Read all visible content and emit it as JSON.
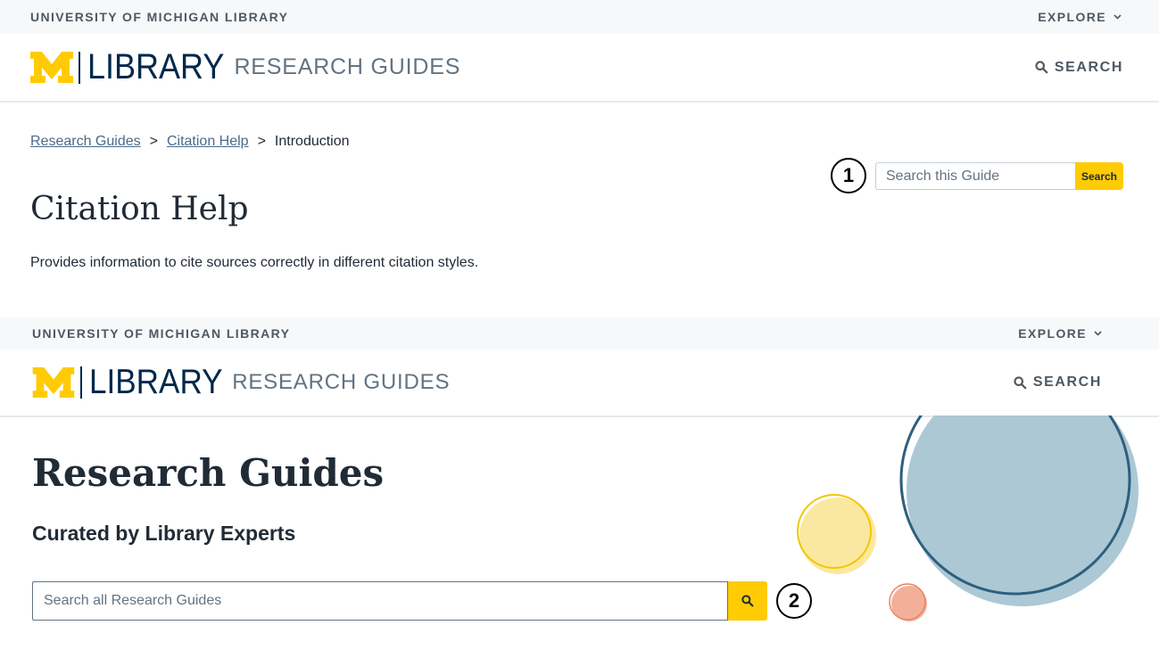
{
  "colors": {
    "maize": "#ffcb05",
    "blue": "#00274c",
    "gray_text": "#4e5862",
    "light_gray": "#f7f8f9"
  },
  "top_banner": {
    "university_label": "UNIVERSITY OF MICHIGAN LIBRARY",
    "explore_label": "EXPLORE",
    "explore_icon": "chevron-down-icon"
  },
  "header": {
    "logo_letter": "M",
    "library_label": "LIBRARY",
    "research_guides_label": "RESEARCH GUIDES",
    "search_label": "SEARCH",
    "search_icon": "search-icon"
  },
  "guide_page": {
    "breadcrumb": {
      "items": [
        "Research Guides",
        "Citation Help"
      ],
      "separator": ">",
      "current": "Introduction"
    },
    "title": "Citation Help",
    "description": "Provides information to cite sources correctly in different citation styles.",
    "search": {
      "placeholder": "Search this Guide",
      "button_label": "Search"
    },
    "callout_number": "1"
  },
  "home_page": {
    "title": "Research Guides",
    "subtitle": "Curated by Library Experts",
    "search": {
      "placeholder": "Search all Research Guides",
      "button_icon": "search-icon"
    },
    "callout_number": "2"
  }
}
